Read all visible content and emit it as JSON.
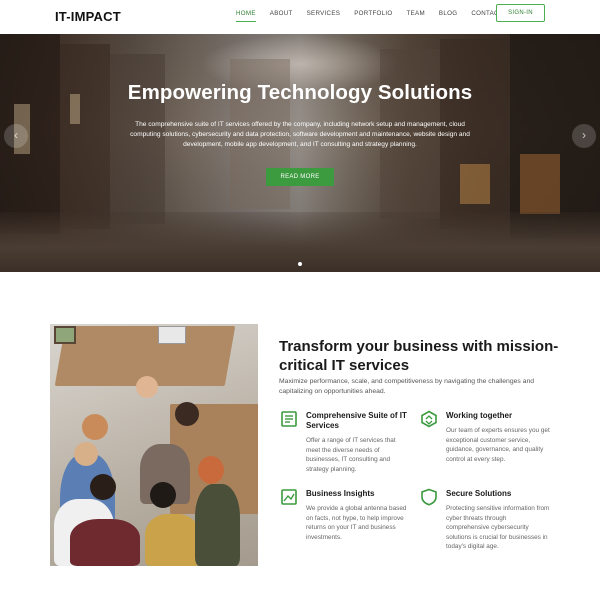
{
  "header": {
    "logo": "IT-IMPACT",
    "nav": [
      "HOME",
      "ABOUT",
      "SERVICES",
      "PORTFOLIO",
      "TEAM",
      "BLOG",
      "CONTACT"
    ],
    "active_nav": "HOME",
    "signin_label": "SIGN-IN"
  },
  "hero": {
    "title": "Empowering Technology Solutions",
    "description": "The comprehensive suite of IT services offered by the company, including network setup and management, cloud computing solutions, cybersecurity and data protection, software development and maintenance, website design and development, mobile app development, and IT consulting and strategy planning.",
    "cta_label": "READ MORE",
    "prev_arrow": "‹",
    "next_arrow": "›"
  },
  "section": {
    "title": "Transform your business with mission-critical IT services",
    "description": "Maximize performance, scale, and competitiveness by navigating the challenges and capitalizing on opportunities ahead.",
    "features": [
      {
        "icon": "document-list-icon",
        "title": "Comprehensive Suite of IT Services",
        "text": "Offer a range of IT services that meet the diverse needs of businesses, IT consulting and strategy planning."
      },
      {
        "icon": "hexagon-arrows-icon",
        "title": "Working together",
        "text": "Our team of experts ensures you get exceptional customer service, guidance, governance, and quality control at every step."
      },
      {
        "icon": "image-chart-icon",
        "title": "Business Insights",
        "text": "We provide a global antenna based on facts, not hype, to help improve returns on your IT and business investments."
      },
      {
        "icon": "shield-icon",
        "title": "Secure Solutions",
        "text": "Protecting sensitive information from cyber threats through comprehensive cybersecurity solutions is crucial for businesses in today's digital age."
      }
    ]
  },
  "colors": {
    "accent": "#3c9a3f",
    "accent_dark": "#2e7d32"
  }
}
